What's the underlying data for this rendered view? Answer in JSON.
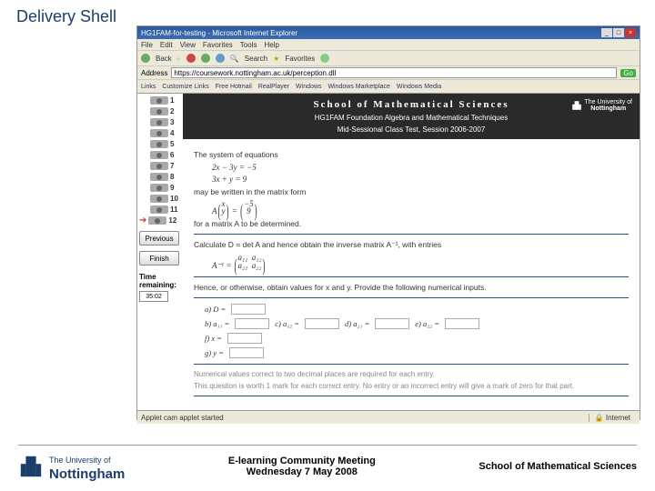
{
  "slide_title": "Delivery Shell",
  "ie": {
    "title": "HG1FAM-for-testing - Microsoft Internet Explorer",
    "menu": [
      "File",
      "Edit",
      "View",
      "Favorites",
      "Tools",
      "Help"
    ],
    "toolbar": {
      "back": "Back",
      "search": "Search",
      "favorites": "Favorites"
    },
    "address_label": "Address",
    "url": "https://coursework.nottingham.ac.uk/perception.dll",
    "links_label": "Links",
    "links": [
      "Customize Links",
      "Free Hotmail",
      "RealPlayer",
      "Windows",
      "Windows Marketplace",
      "Windows Media"
    ]
  },
  "nav": {
    "items": [
      "1",
      "2",
      "3",
      "4",
      "5",
      "6",
      "7",
      "8",
      "9",
      "10",
      "11",
      "12"
    ],
    "current": "12",
    "previous": "Previous",
    "finish": "Finish",
    "time_label": "Time remaining:",
    "time_value": "35:02"
  },
  "banner": {
    "school": "School of Mathematical Sciences",
    "course": "HG1FAM Foundation Algebra and Mathematical Techniques",
    "test": "Mid-Sessional Class Test, Session 2006-2007",
    "uni": "The University of",
    "uni2": "Nottingham"
  },
  "q": {
    "p1": "The system of equations",
    "eq1": "2x − 3y  =  −5",
    "eq2": "3x + y  =   9",
    "p2": "may be written in the matrix form",
    "p3": "for a matrix A to be determined.",
    "p4": "Calculate D = det A and hence obtain the inverse matrix A⁻¹, with entries",
    "p5": "Hence, or otherwise, obtain values for x and y. Provide the following numerical inputs.",
    "labels": {
      "a": "a)  D  =",
      "b": "b)  a₁₁  =",
      "c": "c)  a₁₂  =",
      "d": "d)  a₂₁  =",
      "e": "e)  a₂₂  =",
      "f": "f)  x  =",
      "g": "g)  y  ="
    },
    "note1": "Numerical values correct to two decimal places are required for each entry.",
    "note2": "This question is worth 1 mark for each correct entry. No entry or an incorrect entry will give a mark of zero for that part."
  },
  "status": {
    "left": "Applet cam applet started",
    "right": "Internet"
  },
  "footer": {
    "uni_prefix": "The University of",
    "uni_name": "Nottingham",
    "meeting": "E-learning Community Meeting",
    "date": "Wednesday 7 May 2008",
    "school": "School of Mathematical Sciences"
  }
}
